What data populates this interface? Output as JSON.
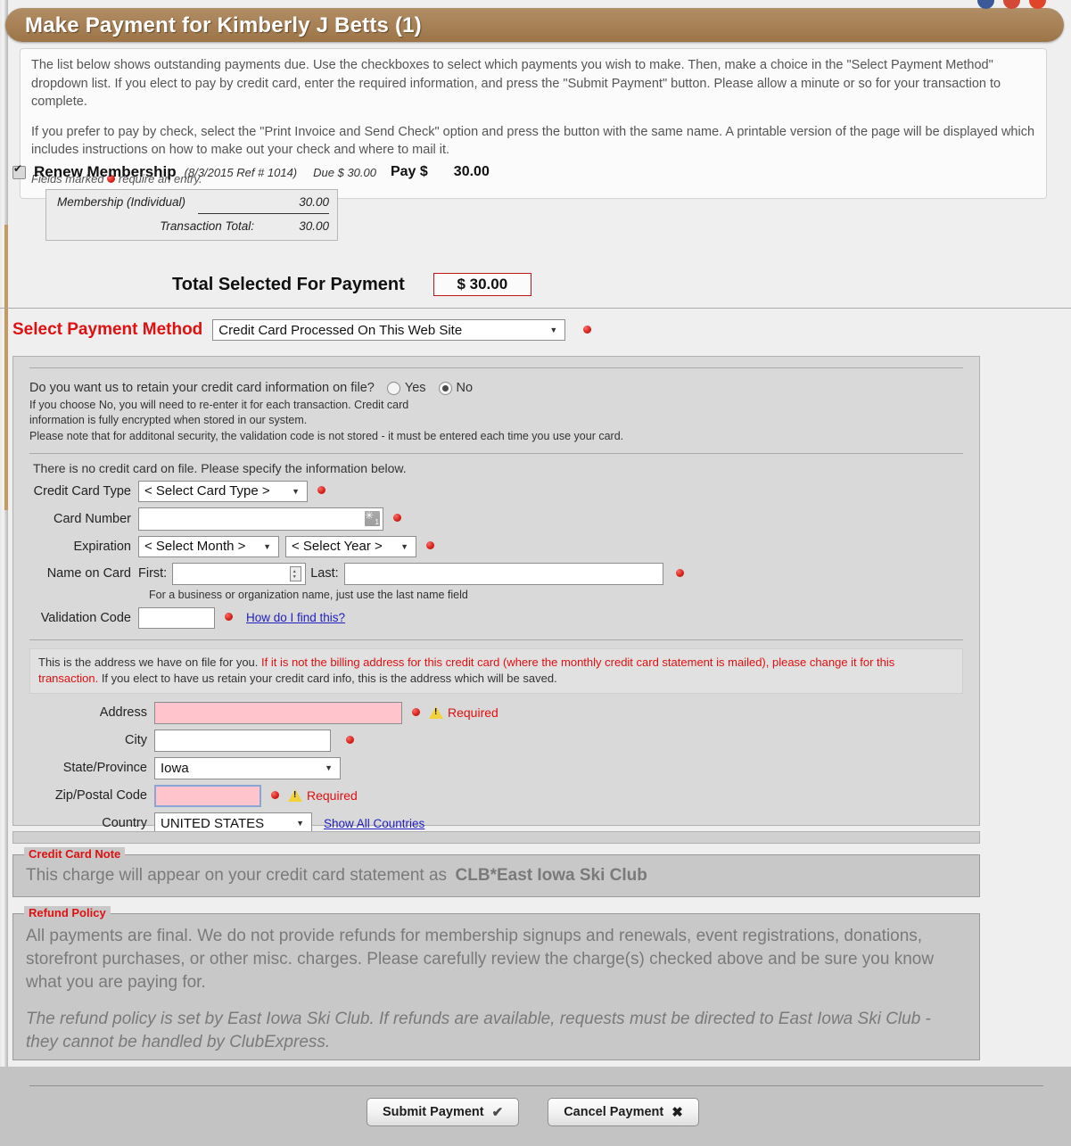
{
  "page": {
    "title": "Make Payment for Kimberly J Betts (1)"
  },
  "social_icons": [
    "facebook-icon",
    "google-plus-icon",
    "rss-icon"
  ],
  "instructions": {
    "paragraph1": "The list below shows outstanding payments due. Use the checkboxes to select which payments you wish to make. Then, make a choice in the \"Select Payment Method\" dropdown list. If you elect to pay by credit card, enter the required information, and press the \"Submit Payment\" button. Please allow a minute or so for your transaction to complete.",
    "paragraph2": "If you prefer to pay by check, select the \"Print Invoice and Send Check\" option and press the button with the same name. A printable version of the page will be displayed which includes instructions on how to make out your check and where to mail it.",
    "fields_note_before": "Fields marked",
    "fields_note_after": "require an entry."
  },
  "payment_item": {
    "checked": true,
    "title": "Renew Membership",
    "meta": "(8/3/2015  Ref # 1014)",
    "due_label": "Due $ 30.00",
    "pay_label": "Pay $",
    "pay_amount": "30.00",
    "detail_rows": [
      {
        "label": "Membership (Individual)",
        "value": "30.00"
      }
    ],
    "transaction_total_label": "Transaction Total:",
    "transaction_total_value": "30.00"
  },
  "total": {
    "label": "Total Selected For Payment",
    "value": "$ 30.00",
    "border_color": "#c11414"
  },
  "payment_method": {
    "label": "Select Payment Method",
    "selected": "Credit Card Processed On This Web Site",
    "label_color": "#e01010"
  },
  "retain": {
    "question": "Do you want us to retain your credit card information on file?",
    "yes_label": "Yes",
    "no_label": "No",
    "selected": "No",
    "note_line1": "If you choose No, you will need to re-enter it for each transaction. Credit card",
    "note_line2": "information is fully encrypted when stored in our system.",
    "note_line3": "Please note that for additonal security, the validation code is not stored - it must be entered each time you use your card."
  },
  "credit_card": {
    "no_card_message": "There is no credit card on file. Please specify the information below.",
    "card_type_label": "Credit Card Type",
    "card_type_value": "< Select Card Type >",
    "card_number_label": "Card Number",
    "card_number_value": "",
    "expiration_label": "Expiration",
    "expiration_month_value": "< Select Month >",
    "expiration_year_value": "< Select Year >",
    "name_on_card_label": "Name on Card",
    "first_label": "First:",
    "first_value": "",
    "last_label": "Last:",
    "last_value": "",
    "name_hint": "For a business or organization name, just use the last name field",
    "validation_code_label": "Validation Code",
    "validation_code_value": "",
    "how_do_i_find_this": "How do I find this?"
  },
  "address": {
    "note_plain1": "This is the address we have on file for you. ",
    "note_red": "If it is not the billing address for this credit card (where the monthly credit card statement is mailed), please change it for this transaction.",
    "note_plain2": " If you elect to have us retain your credit card info, this is the address which will be saved.",
    "address_label": "Address",
    "address_value": "",
    "address_required": "Required",
    "city_label": "City",
    "city_value": "",
    "state_label": "State/Province",
    "state_value": "Iowa",
    "zip_label": "Zip/Postal Code",
    "zip_value": "",
    "zip_required": "Required",
    "country_label": "Country",
    "country_value": "UNITED STATES",
    "show_all_countries": "Show All Countries"
  },
  "credit_card_note": {
    "legend": "Credit Card Note",
    "text": "This charge will appear on your credit card statement as",
    "descriptor": "CLB*East Iowa Ski Club"
  },
  "refund_policy": {
    "legend": "Refund Policy",
    "paragraph1": "All payments are final. We do not provide refunds for membership signups and renewals, event registrations, donations, storefront purchases, or other misc. charges. Please carefully review the charge(s) checked above and be sure you know what you are paying for.",
    "paragraph2": "The refund policy is set by East Iowa Ski Club. If refunds are available, requests must be directed to East Iowa Ski Club - they cannot be handled by ClubExpress."
  },
  "buttons": {
    "submit_label": "Submit Payment",
    "submit_icon": "check-icon",
    "cancel_label": "Cancel Payment",
    "cancel_icon": "close-icon"
  }
}
